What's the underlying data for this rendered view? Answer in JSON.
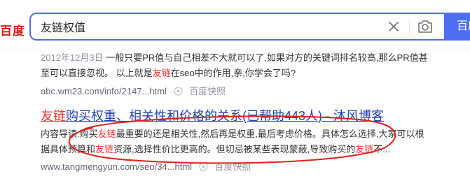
{
  "header": {
    "logo_text": "百度",
    "search_value": "友链权值",
    "search_button_label": "百度一下",
    "clear_icon": "close-icon",
    "camera_icon": "camera-icon"
  },
  "result1": {
    "date": "2012年12月3日",
    "text_a": "一般只要PR值与自己相差不大就可以了,如果对方的关键词排名较高,那么PR值甚至可以直接忽视。 以上就是",
    "hl": "友链",
    "text_b": "在seo中的作用,亲,你学会了吗?",
    "url": "abc.wm23.com/info/2147...html",
    "snapshot": "百度快照"
  },
  "result2": {
    "title_hl": "友链",
    "title_rest": "购买权重、相关性和价格的关系(已帮助443人) - 沐风博客",
    "s_a": "内容导读:购买",
    "s_hl1": "友链",
    "s_b": "最重要的还是相关性,然后再是权重,最后考虑价格。具体怎么选择,大家可以根据具体预算和",
    "s_hl2": "友链",
    "s_c": "资源,选择性价比更高的。但切忌被某些表现蒙蔽,导致购买的",
    "s_hl3": "友链",
    "s_d": "不...",
    "url": "www.tangmengyun.com/seo/34...html",
    "snapshot": "百度快照"
  },
  "colors": {
    "accent": "#4e6ef2",
    "highlight": "#f73131",
    "link": "#2440b3",
    "annotation": "#e0201b"
  }
}
